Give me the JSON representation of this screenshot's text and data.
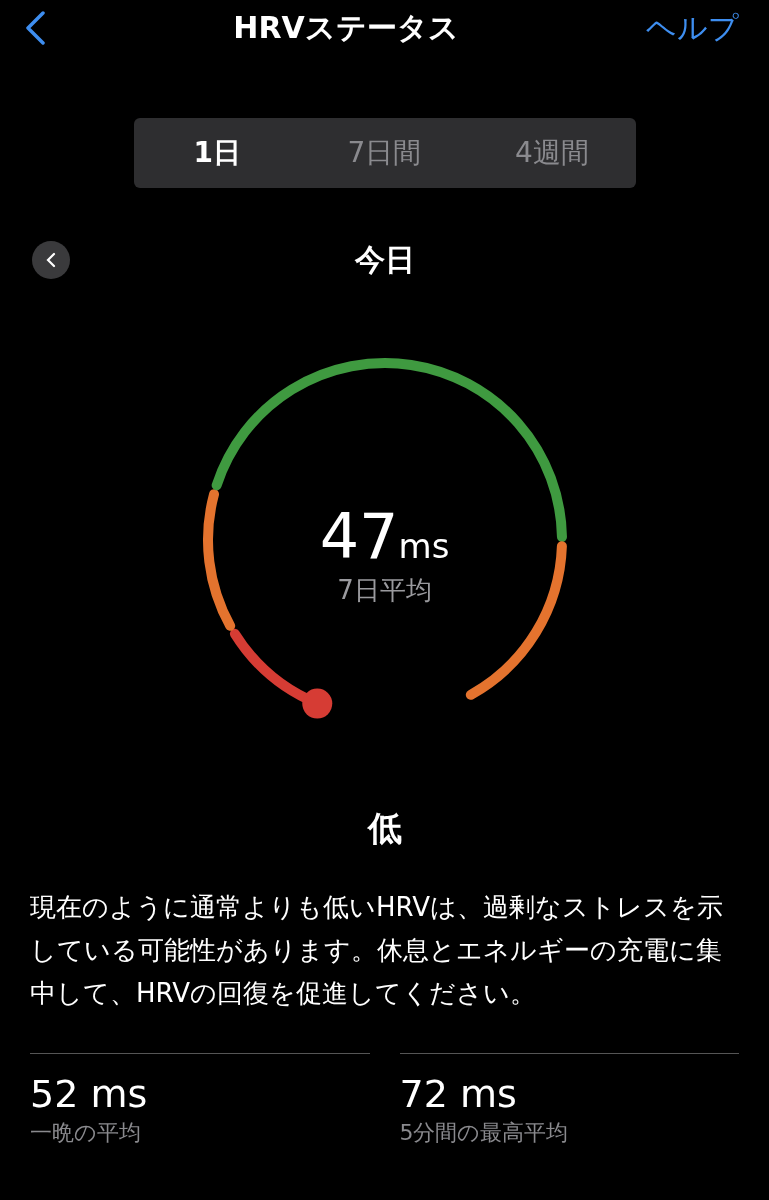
{
  "header": {
    "title": "HRVステータス",
    "help": "ヘルプ"
  },
  "tabs": [
    {
      "label": "1日",
      "selected": true
    },
    {
      "label": "7日間",
      "selected": false
    },
    {
      "label": "4週間",
      "selected": false
    }
  ],
  "period": {
    "title": "今日"
  },
  "gauge": {
    "value": "47",
    "unit": "ms",
    "caption": "7日平均",
    "zones": [
      {
        "color": "#d63c34"
      },
      {
        "color": "#e4732e"
      },
      {
        "color": "#3f9a40"
      },
      {
        "color": "#e4732e"
      }
    ]
  },
  "status": {
    "label": "低",
    "description": "現在のように通常よりも低いHRVは、過剰なストレスを示している可能性があります。休息とエネルギーの充電に集中して、HRVの回復を促進してください。"
  },
  "stats": [
    {
      "value": "52 ms",
      "label": "一晩の平均"
    },
    {
      "value": "72 ms",
      "label": "5分間の最高平均"
    }
  ]
}
